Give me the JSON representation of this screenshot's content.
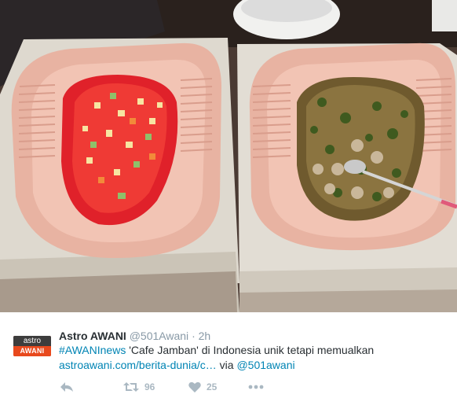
{
  "photo": {
    "alt_icon": "photo-icon",
    "description_icon": "squat-toilet-dishes-photo"
  },
  "author": {
    "name": "Astro AWANI",
    "handle": "@501Awani",
    "separator": "·",
    "time": "2h",
    "avatar_top": "astro",
    "avatar_bottom": "AWANI"
  },
  "tweet": {
    "hashtag": "#AWANInews",
    "text": " 'Cafe Jamban' di Indonesia unik tetapi memualkan",
    "url": "astroawani.com/berita-dunia/c…",
    "via_text": " via ",
    "mention": "@501awani"
  },
  "actions": {
    "reply_icon": "reply-icon",
    "retweet_icon": "retweet-icon",
    "retweet_count": "96",
    "like_icon": "heart-icon",
    "like_count": "25",
    "more_icon": "more-icon"
  },
  "colors": {
    "link": "#0084b4",
    "text": "#292f33",
    "muted": "#8899a6",
    "action": "#aab8c2",
    "avatar_red": "#e8491d"
  }
}
